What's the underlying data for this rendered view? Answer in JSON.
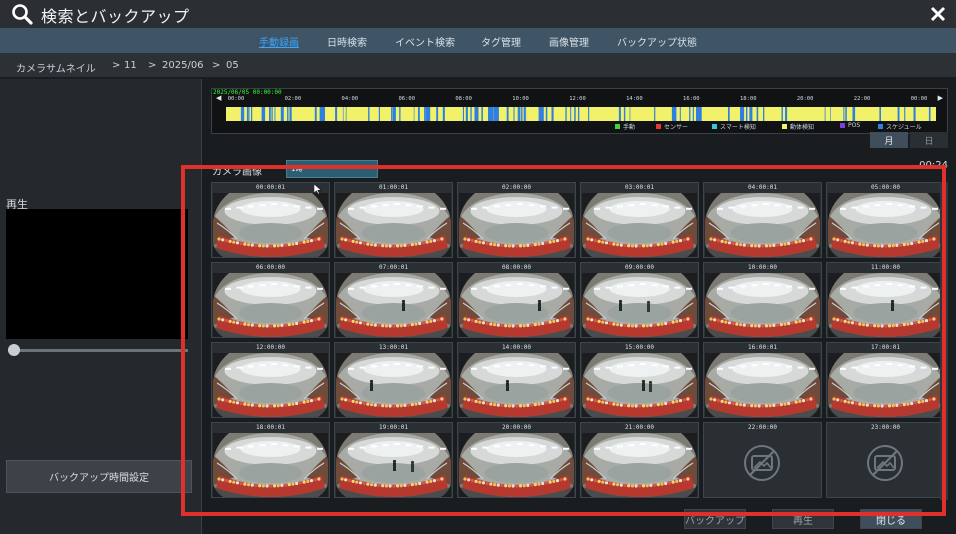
{
  "window": {
    "title": "検索とバックアップ",
    "search_icon": "search-icon",
    "close_icon": "close-icon"
  },
  "tabs": [
    {
      "label": "手動録画",
      "active": true
    },
    {
      "label": "日時検索",
      "active": false
    },
    {
      "label": "イベント検索",
      "active": false
    },
    {
      "label": "タグ管理",
      "active": false
    },
    {
      "label": "画像管理",
      "active": false
    },
    {
      "label": "バックアップ状態",
      "active": false
    }
  ],
  "breadcrumb": {
    "root": "カメラサムネイル",
    "sep": ">",
    "items": [
      "11",
      "2025/06",
      "05"
    ]
  },
  "left_panel": {
    "play_label": "再生",
    "backup_time_button": "バックアップ時間設定"
  },
  "timeline": {
    "date_label": "2025/06/05 00:00:00",
    "ticks": [
      "00:00",
      "02:00",
      "04:00",
      "06:00",
      "08:00",
      "10:00",
      "12:00",
      "14:00",
      "16:00",
      "18:00",
      "20:00",
      "22:00",
      "00:00"
    ],
    "prev_arrow": "◀",
    "next_arrow": "▶",
    "legend": [
      {
        "label": "手動",
        "color": "#3fd43f"
      },
      {
        "label": "センサー",
        "color": "#e53935"
      },
      {
        "label": "スマート検知",
        "color": "#39c6d6"
      },
      {
        "label": "動体検知",
        "color": "#f2f16a"
      },
      {
        "label": "POS",
        "color": "#7b3fe0"
      },
      {
        "label": "スケジュール",
        "color": "#2f7fe0"
      }
    ],
    "colors": {
      "motion": "#f2f16a",
      "schedule": "#2f7fe0"
    }
  },
  "view_mode": {
    "month": "月",
    "day": "日",
    "selected": "month"
  },
  "thumbnails_header": {
    "camera_label": "カメラ画像",
    "camera_select_value": "1時",
    "chevron": "⌄",
    "count": "00:24"
  },
  "thumbnails": [
    {
      "time": "00:00:01",
      "has_image": true
    },
    {
      "time": "01:00:01",
      "has_image": true
    },
    {
      "time": "02:00:00",
      "has_image": true
    },
    {
      "time": "03:00:01",
      "has_image": true
    },
    {
      "time": "04:00:01",
      "has_image": true
    },
    {
      "time": "05:00:00",
      "has_image": true
    },
    {
      "time": "06:00:00",
      "has_image": true
    },
    {
      "time": "07:00:01",
      "has_image": true
    },
    {
      "time": "08:00:00",
      "has_image": true
    },
    {
      "time": "09:00:00",
      "has_image": true
    },
    {
      "time": "10:00:00",
      "has_image": true
    },
    {
      "time": "11:00:00",
      "has_image": true
    },
    {
      "time": "12:00:00",
      "has_image": true
    },
    {
      "time": "13:00:01",
      "has_image": true
    },
    {
      "time": "14:00:00",
      "has_image": true
    },
    {
      "time": "15:00:00",
      "has_image": true
    },
    {
      "time": "16:00:01",
      "has_image": true
    },
    {
      "time": "17:00:01",
      "has_image": true
    },
    {
      "time": "18:00:01",
      "has_image": true
    },
    {
      "time": "19:00:01",
      "has_image": true
    },
    {
      "time": "20:00:00",
      "has_image": true
    },
    {
      "time": "21:00:00",
      "has_image": true
    },
    {
      "time": "22:00:00",
      "has_image": false
    },
    {
      "time": "23:00:00",
      "has_image": false
    }
  ],
  "bottom_buttons": {
    "backup": "バックアップ",
    "play": "再生",
    "close": "閉じる"
  },
  "annotation": {
    "highlight_color": "#e0302b"
  }
}
